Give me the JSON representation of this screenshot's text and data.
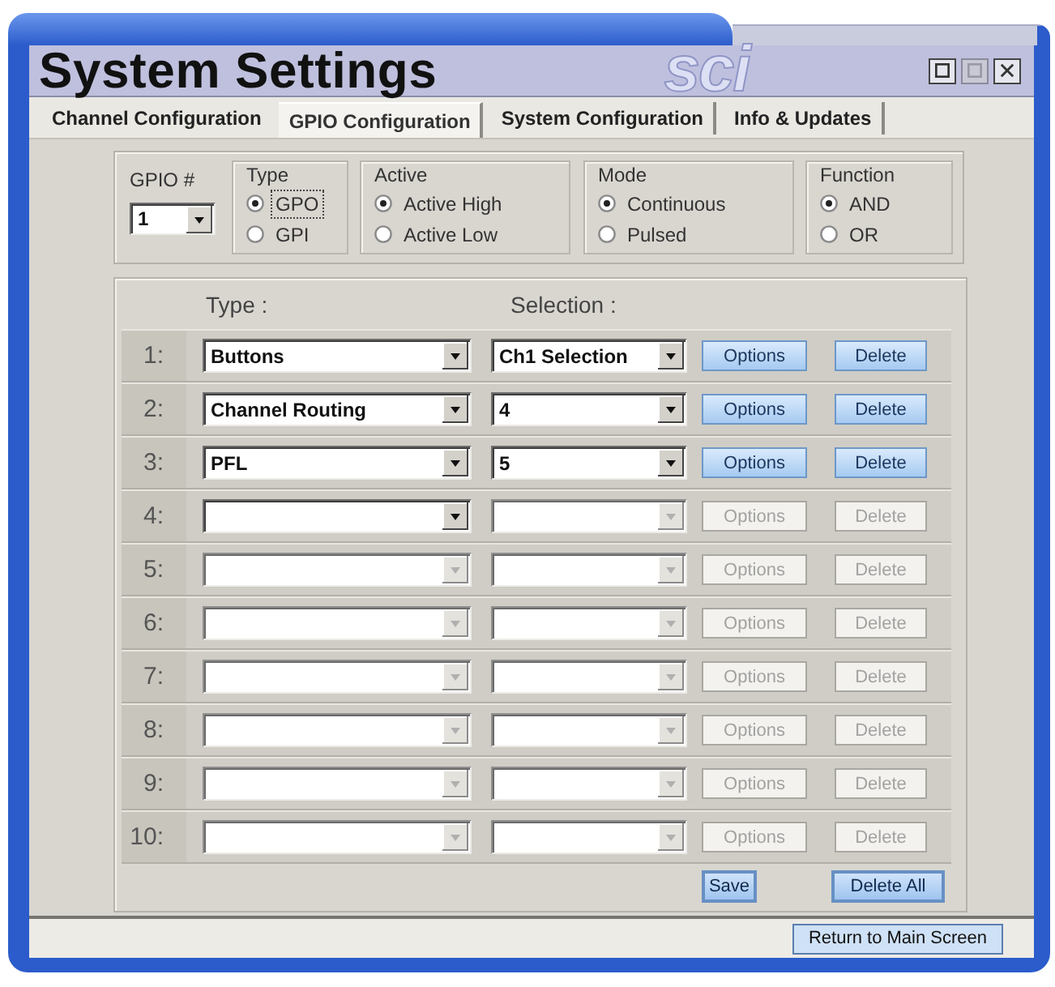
{
  "window": {
    "title": "System Settings",
    "logo": "sci"
  },
  "window_buttons": [
    {
      "kind": "box",
      "disabled": false
    },
    {
      "kind": "box",
      "disabled": true
    },
    {
      "kind": "close",
      "disabled": false
    }
  ],
  "tabs": [
    {
      "label": "Channel Configuration",
      "selected": false
    },
    {
      "label": "GPIO Configuration",
      "selected": true
    },
    {
      "label": "System Configuration",
      "selected": false
    },
    {
      "label": "Info & Updates",
      "selected": false
    }
  ],
  "gpio": {
    "label": "GPIO #",
    "value": "1"
  },
  "option_groups": [
    {
      "title": "Type",
      "options": [
        {
          "label": "GPO",
          "selected": true,
          "focused": true
        },
        {
          "label": "GPI",
          "selected": false,
          "focused": false
        }
      ]
    },
    {
      "title": "Active",
      "options": [
        {
          "label": "Active High",
          "selected": true,
          "focused": false
        },
        {
          "label": "Active Low",
          "selected": false,
          "focused": false
        }
      ]
    },
    {
      "title": "Mode",
      "options": [
        {
          "label": "Continuous",
          "selected": true,
          "focused": false
        },
        {
          "label": "Pulsed",
          "selected": false,
          "focused": false
        }
      ]
    },
    {
      "title": "Function",
      "options": [
        {
          "label": "AND",
          "selected": true,
          "focused": false
        },
        {
          "label": "OR",
          "selected": false,
          "focused": false
        }
      ]
    }
  ],
  "table": {
    "columns": [
      "Type :",
      "Selection :"
    ],
    "rows": [
      {
        "number": "1:",
        "type": {
          "value": "Buttons",
          "disabled": false
        },
        "selection": {
          "value": "Ch1 Selection",
          "disabled": false
        },
        "options_button": {
          "label": "Options",
          "disabled": false
        },
        "delete_button": {
          "label": "Delete",
          "disabled": false
        }
      },
      {
        "number": "2:",
        "type": {
          "value": "Channel Routing",
          "disabled": false
        },
        "selection": {
          "value": "4",
          "disabled": false
        },
        "options_button": {
          "label": "Options",
          "disabled": false
        },
        "delete_button": {
          "label": "Delete",
          "disabled": false
        }
      },
      {
        "number": "3:",
        "type": {
          "value": "PFL",
          "disabled": false
        },
        "selection": {
          "value": "5",
          "disabled": false
        },
        "options_button": {
          "label": "Options",
          "disabled": false
        },
        "delete_button": {
          "label": "Delete",
          "disabled": false
        }
      },
      {
        "number": "4:",
        "type": {
          "disabled": false
        },
        "selection": {
          "disabled": true
        },
        "options_button": {
          "label": "Options",
          "disabled": true
        },
        "delete_button": {
          "label": "Delete",
          "disabled": true
        }
      },
      {
        "number": "5:",
        "type": {
          "disabled": true
        },
        "selection": {
          "disabled": true
        },
        "options_button": {
          "label": "Options",
          "disabled": true
        },
        "delete_button": {
          "label": "Delete",
          "disabled": true
        }
      },
      {
        "number": "6:",
        "type": {
          "disabled": true
        },
        "selection": {
          "disabled": true
        },
        "options_button": {
          "label": "Options",
          "disabled": true
        },
        "delete_button": {
          "label": "Delete",
          "disabled": true
        }
      },
      {
        "number": "7:",
        "type": {
          "disabled": true
        },
        "selection": {
          "disabled": true
        },
        "options_button": {
          "label": "Options",
          "disabled": true
        },
        "delete_button": {
          "label": "Delete",
          "disabled": true
        }
      },
      {
        "number": "8:",
        "type": {
          "disabled": true
        },
        "selection": {
          "disabled": true
        },
        "options_button": {
          "label": "Options",
          "disabled": true
        },
        "delete_button": {
          "label": "Delete",
          "disabled": true
        }
      },
      {
        "number": "9:",
        "type": {
          "disabled": true
        },
        "selection": {
          "disabled": true
        },
        "options_button": {
          "label": "Options",
          "disabled": true
        },
        "delete_button": {
          "label": "Delete",
          "disabled": true
        }
      },
      {
        "number": "10:",
        "type": {
          "disabled": true
        },
        "selection": {
          "disabled": true
        },
        "options_button": {
          "label": "Options",
          "disabled": true
        },
        "delete_button": {
          "label": "Delete",
          "disabled": true
        }
      }
    ],
    "save_button": "Save",
    "delete_all_button": "Delete All"
  },
  "status_bar": {
    "return_button": "Return to Main Screen"
  }
}
